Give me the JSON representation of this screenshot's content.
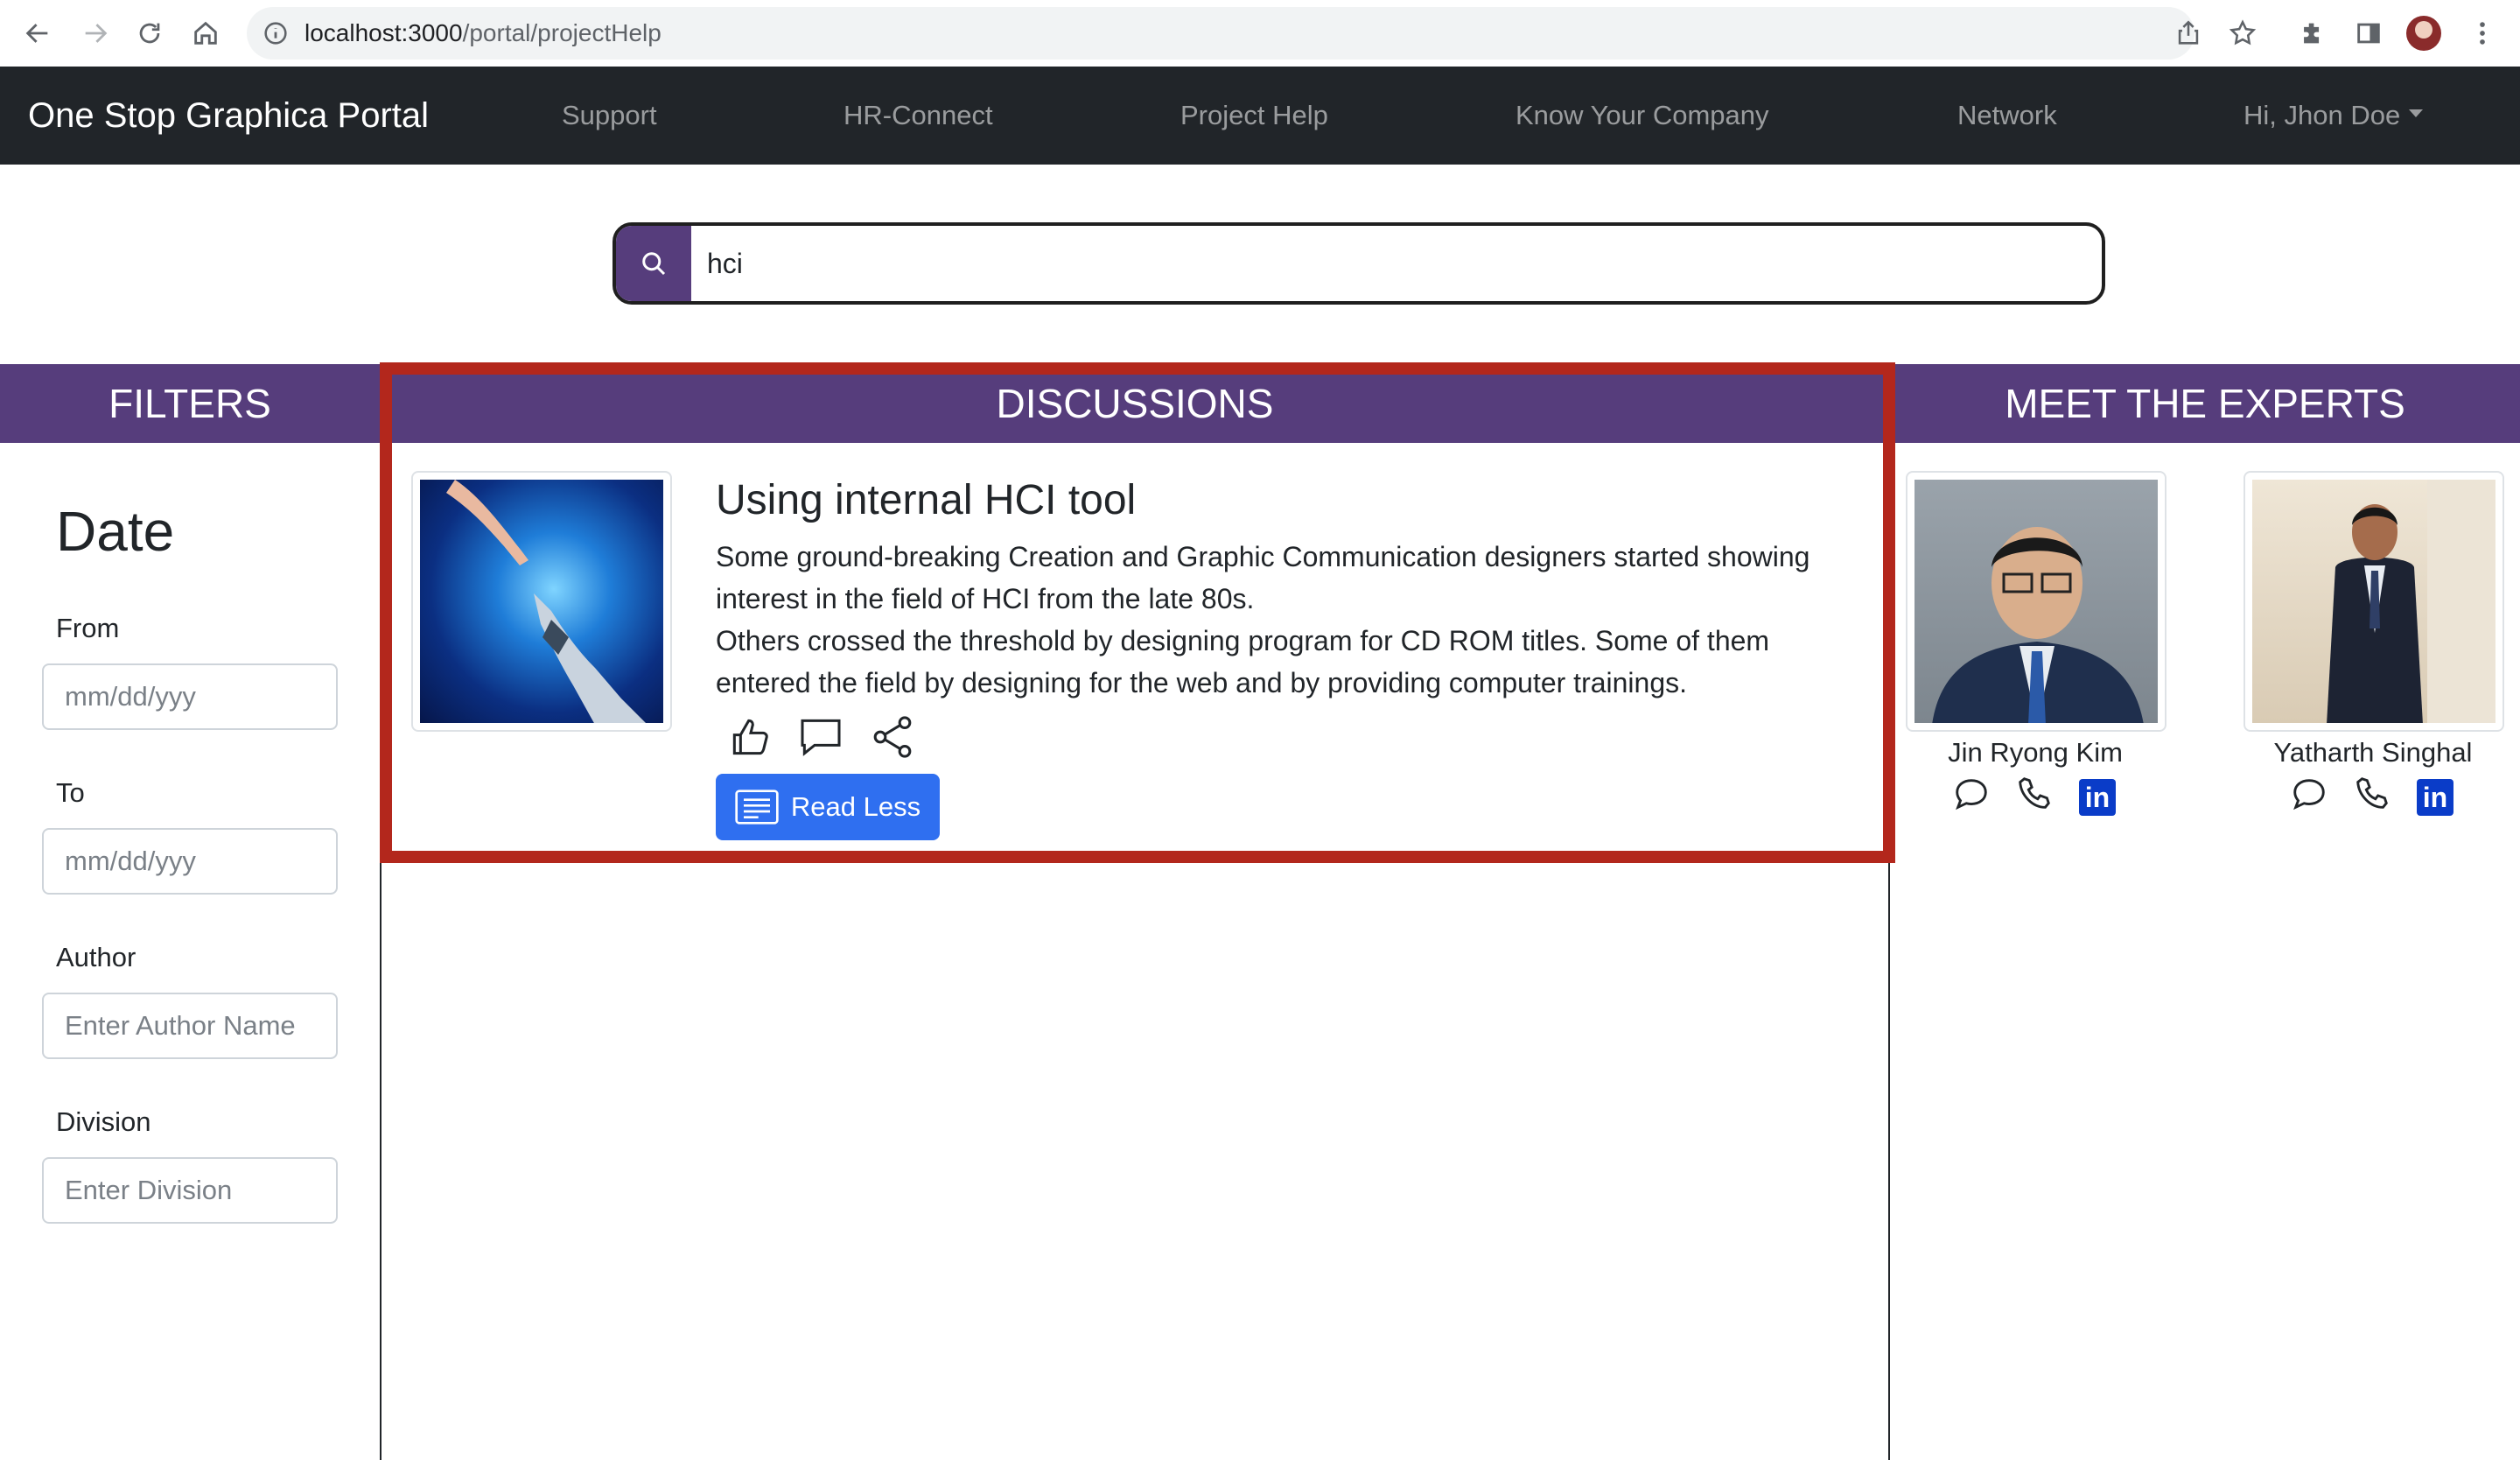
{
  "browser": {
    "url_host": "localhost:3000",
    "url_path": "/portal/projectHelp"
  },
  "navbar": {
    "brand": "One Stop Graphica Portal",
    "links": [
      "Support",
      "HR-Connect",
      "Project Help",
      "Know Your Company",
      "Network"
    ],
    "user_menu": "Hi, Jhon Doe"
  },
  "search": {
    "value": "hci"
  },
  "filters": {
    "header": "FILTERS",
    "date_title": "Date",
    "from_label": "From",
    "from_placeholder": "mm/dd/yyy",
    "to_label": "To",
    "to_placeholder": "mm/dd/yyy",
    "author_label": "Author",
    "author_placeholder": "Enter Author Name",
    "division_label": "Division",
    "division_placeholder": "Enter Division"
  },
  "discussions": {
    "header": "DISCUSSIONS",
    "post": {
      "title": "Using internal HCI tool",
      "paragraph1": "Some ground-breaking Creation and Graphic Communication designers started showing interest in the field of HCI from the late 80s.",
      "paragraph2": "Others crossed the threshold by designing program for CD ROM titles. Some of them entered the field by designing for the web and by providing computer trainings.",
      "read_button": "Read Less"
    }
  },
  "experts": {
    "header": "MEET THE EXPERTS",
    "people": [
      {
        "name": "Jin Ryong Kim"
      },
      {
        "name": "Yatharth Singhal"
      }
    ]
  },
  "colors": {
    "navbar_bg": "#212529",
    "section_header_bg": "#563d7c",
    "highlight_border": "#b3271c",
    "primary_button": "#2f6ff0",
    "linkedin": "#0a3cc8"
  }
}
